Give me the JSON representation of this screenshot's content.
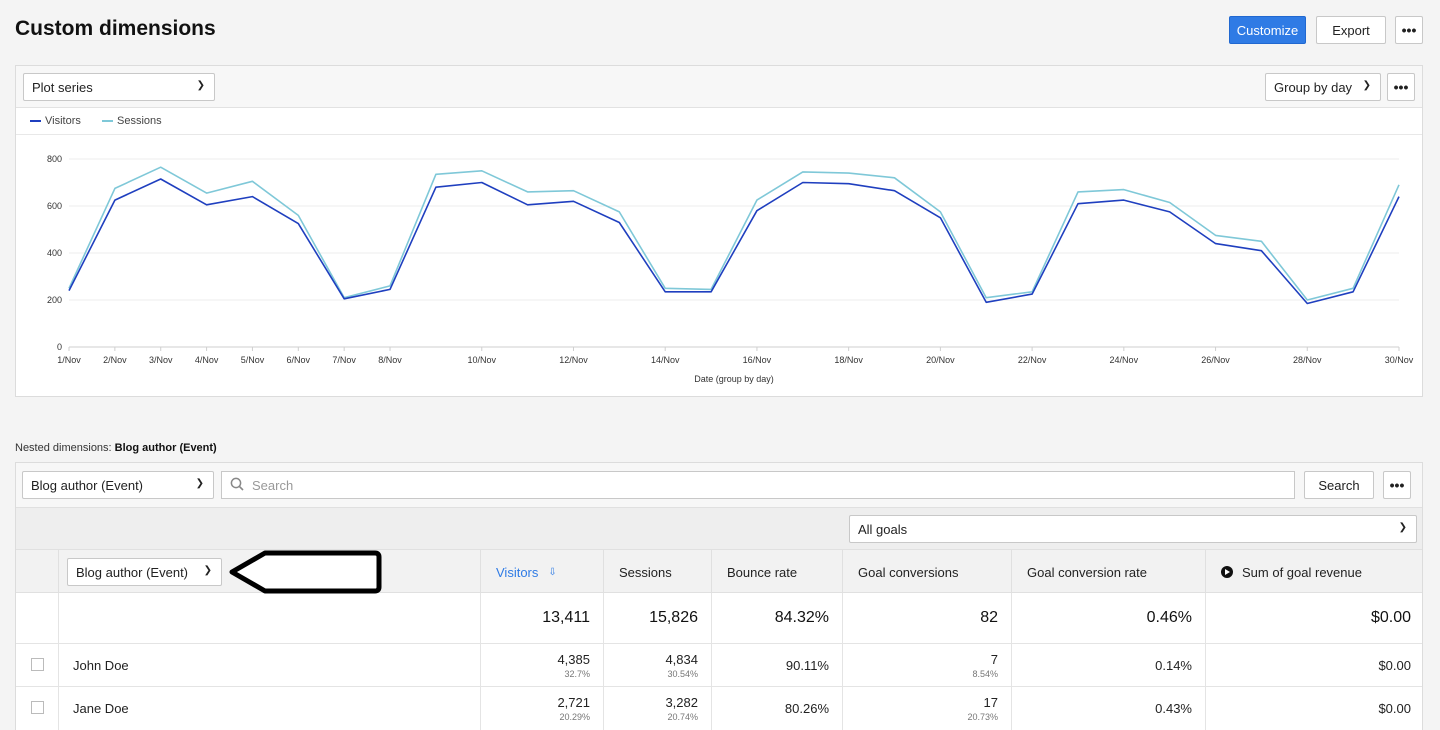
{
  "header": {
    "title": "Custom dimensions",
    "customize_label": "Customize",
    "export_label": "Export",
    "more_label": "•••"
  },
  "chart_panel": {
    "plot_series_label": "Plot series",
    "group_by_label": "Group by day",
    "more_label": "•••"
  },
  "chart_data": {
    "type": "line",
    "xlabel": "Date (group by day)",
    "ylabel": "",
    "ylim": [
      0,
      800
    ],
    "yticks": [
      0,
      200,
      400,
      600,
      800
    ],
    "x": [
      "1/Nov",
      "2/Nov",
      "3/Nov",
      "4/Nov",
      "5/Nov",
      "6/Nov",
      "7/Nov",
      "8/Nov",
      "9/Nov",
      "10/Nov",
      "11/Nov",
      "12/Nov",
      "13/Nov",
      "14/Nov",
      "15/Nov",
      "16/Nov",
      "17/Nov",
      "18/Nov",
      "19/Nov",
      "20/Nov",
      "21/Nov",
      "22/Nov",
      "23/Nov",
      "24/Nov",
      "25/Nov",
      "26/Nov",
      "27/Nov",
      "28/Nov",
      "29/Nov",
      "30/Nov"
    ],
    "xtick_labels": [
      "1/Nov",
      "2/Nov",
      "3/Nov",
      "4/Nov",
      "5/Nov",
      "6/Nov",
      "7/Nov",
      "8/Nov",
      "10/Nov",
      "12/Nov",
      "14/Nov",
      "16/Nov",
      "18/Nov",
      "20/Nov",
      "22/Nov",
      "24/Nov",
      "26/Nov",
      "28/Nov",
      "30/Nov"
    ],
    "series": [
      {
        "name": "Visitors",
        "color": "#1f3fbf",
        "values": [
          240,
          625,
          715,
          605,
          640,
          525,
          205,
          245,
          680,
          700,
          605,
          620,
          530,
          235,
          235,
          580,
          700,
          695,
          665,
          550,
          190,
          225,
          610,
          625,
          575,
          440,
          410,
          185,
          235,
          640
        ]
      },
      {
        "name": "Sessions",
        "color": "#7fc8d8",
        "values": [
          250,
          675,
          765,
          655,
          705,
          560,
          210,
          260,
          735,
          750,
          660,
          665,
          575,
          250,
          245,
          625,
          745,
          740,
          720,
          575,
          210,
          235,
          660,
          670,
          615,
          475,
          450,
          200,
          250,
          690
        ]
      }
    ],
    "grid": true,
    "legend_position": "top-left"
  },
  "nested": {
    "prefix": "Nested dimensions:",
    "value": "Blog author (Event)"
  },
  "table": {
    "dimension_select": "Blog author (Event)",
    "search_placeholder": "Search",
    "search_button": "Search",
    "more_label": "•••",
    "goals_select": "All goals",
    "column_dimension_select": "Blog author (Event)",
    "columns": [
      "Visitors",
      "Sessions",
      "Bounce rate",
      "Goal conversions",
      "Goal conversion rate",
      "Sum of goal revenue"
    ],
    "totals": [
      "13,411",
      "15,826",
      "84.32%",
      "82",
      "0.46%",
      "$0.00"
    ],
    "rows": [
      {
        "name": "John Doe",
        "visitors": "4,385",
        "visitors_pct": "32.7%",
        "sessions": "4,834",
        "sessions_pct": "30.54%",
        "bounce": "90.11%",
        "conversions": "7",
        "conversions_pct": "8.54%",
        "conv_rate": "0.14%",
        "revenue": "$0.00"
      },
      {
        "name": "Jane Doe",
        "visitors": "2,721",
        "visitors_pct": "20.29%",
        "sessions": "3,282",
        "sessions_pct": "20.74%",
        "bounce": "80.26%",
        "conversions": "17",
        "conversions_pct": "20.73%",
        "conv_rate": "0.43%",
        "revenue": "$0.00"
      }
    ]
  }
}
